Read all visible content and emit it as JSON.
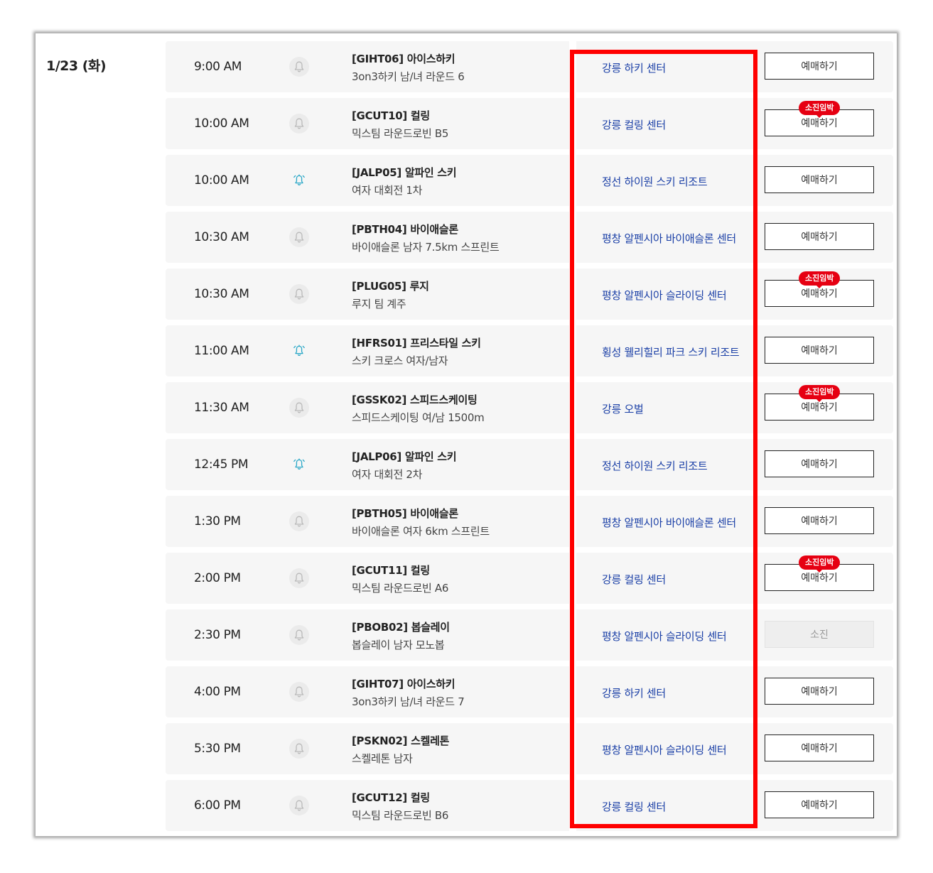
{
  "date": "1/23 (화)",
  "book_label": "예매하기",
  "soldout_label": "소진",
  "badge_label": "소진임박",
  "colors": {
    "venue_link": "#1a3fa6",
    "badge": "#e60012",
    "highlight": "#ff0000",
    "bell_active": "#29a7c7"
  },
  "events": [
    {
      "time": "9:00 AM",
      "title": "[GIHT06] 아이스하키",
      "sub": "3on3하키 남/녀 라운드 6",
      "venue": "강릉 하키 센터",
      "bell": "bell-icon",
      "status": "available"
    },
    {
      "time": "10:00 AM",
      "title": "[GCUT10] 컬링",
      "sub": "믹스팀 라운드로빈 B5",
      "venue": "강릉 컬링 센터",
      "bell": "bell-icon",
      "status": "almost"
    },
    {
      "time": "10:00 AM",
      "title": "[JALP05] 알파인 스키",
      "sub": "여자 대회전 1차",
      "venue": "정선 하이원 스키 리조트",
      "bell": "bell-ringing-icon",
      "status": "available"
    },
    {
      "time": "10:30 AM",
      "title": "[PBTH04] 바이애슬론",
      "sub": "바이애슬론 남자 7.5km 스프린트",
      "venue": "평창 알펜시아 바이애슬론 센터",
      "bell": "bell-icon",
      "status": "available"
    },
    {
      "time": "10:30 AM",
      "title": "[PLUG05] 루지",
      "sub": "루지 팀 계주",
      "venue": "평창 알펜시아 슬라이딩 센터",
      "bell": "bell-icon",
      "status": "almost"
    },
    {
      "time": "11:00 AM",
      "title": "[HFRS01] 프리스타일 스키",
      "sub": "스키 크로스 여자/남자",
      "venue": "횡성 웰리힐리 파크 스키 리조트",
      "bell": "bell-ringing-icon",
      "status": "available"
    },
    {
      "time": "11:30 AM",
      "title": "[GSSK02] 스피드스케이팅",
      "sub": "스피드스케이팅 여/남 1500m",
      "venue": "강릉 오벌",
      "bell": "bell-icon",
      "status": "almost"
    },
    {
      "time": "12:45 PM",
      "title": "[JALP06] 알파인 스키",
      "sub": "여자 대회전 2차",
      "venue": "정선 하이원 스키 리조트",
      "bell": "bell-ringing-icon",
      "status": "available"
    },
    {
      "time": "1:30 PM",
      "title": "[PBTH05] 바이애슬론",
      "sub": "바이애슬론 여자 6km 스프린트",
      "venue": "평창 알펜시아 바이애슬론 센터",
      "bell": "bell-icon",
      "status": "available"
    },
    {
      "time": "2:00 PM",
      "title": "[GCUT11] 컬링",
      "sub": "믹스팀 라운드로빈 A6",
      "venue": "강릉 컬링 센터",
      "bell": "bell-icon",
      "status": "almost"
    },
    {
      "time": "2:30 PM",
      "title": "[PBOB02] 봅슬레이",
      "sub": "봅슬레이 남자 모노봅",
      "venue": "평창 알펜시아 슬라이딩 센터",
      "bell": "bell-icon",
      "status": "soldout"
    },
    {
      "time": "4:00 PM",
      "title": "[GIHT07] 아이스하키",
      "sub": "3on3하키 남/녀 라운드 7",
      "venue": "강릉 하키 센터",
      "bell": "bell-icon",
      "status": "available"
    },
    {
      "time": "5:30 PM",
      "title": "[PSKN02] 스켈레톤",
      "sub": "스켈레톤 남자",
      "venue": "평창 알펜시아 슬라이딩 센터",
      "bell": "bell-icon",
      "status": "available"
    },
    {
      "time": "6:00 PM",
      "title": "[GCUT12] 컬링",
      "sub": "믹스팀 라운드로빈 B6",
      "venue": "강릉 컬링 센터",
      "bell": "bell-icon",
      "status": "available"
    }
  ]
}
